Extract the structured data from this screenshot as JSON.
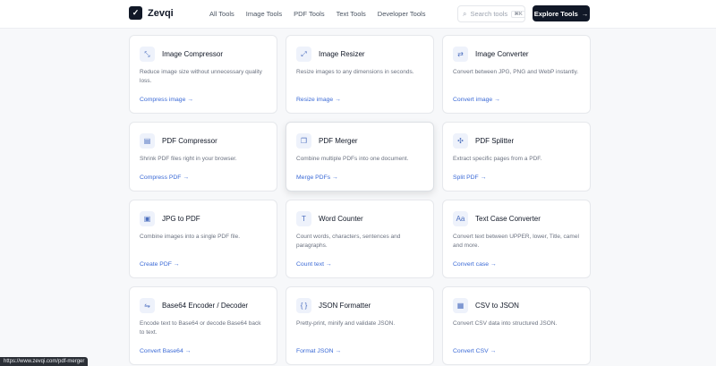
{
  "brand": {
    "name": "Zevqi",
    "mark": "✓"
  },
  "nav": [
    "All Tools",
    "Image Tools",
    "PDF Tools",
    "Text Tools",
    "Developer Tools"
  ],
  "search": {
    "placeholder": "Search tools",
    "shortcut": "⌘K"
  },
  "cta": {
    "label": "Explore Tools",
    "arrow": "→"
  },
  "cards": [
    {
      "title": "Image Compressor",
      "desc": "Reduce image size without unnecessary quality loss.",
      "link": "Compress image →",
      "icon": "⤡",
      "icon_name": "compress-icon"
    },
    {
      "title": "Image Resizer",
      "desc": "Resize images to any dimensions in seconds.",
      "link": "Resize image →",
      "icon": "⤢",
      "icon_name": "resize-icon"
    },
    {
      "title": "Image Converter",
      "desc": "Convert between JPG, PNG and WebP instantly.",
      "link": "Convert image →",
      "icon": "⇄",
      "icon_name": "convert-icon"
    },
    {
      "title": "PDF Compressor",
      "desc": "Shrink PDF files right in your browser.",
      "link": "Compress PDF →",
      "icon": "▤",
      "icon_name": "pdf-file-icon"
    },
    {
      "title": "PDF Merger",
      "desc": "Combine multiple PDFs into one document.",
      "link": "Merge PDFs →",
      "icon": "❐",
      "icon_name": "merge-icon"
    },
    {
      "title": "PDF Splitter",
      "desc": "Extract specific pages from a PDF.",
      "link": "Split PDF →",
      "icon": "✣",
      "icon_name": "split-icon"
    },
    {
      "title": "JPG to PDF",
      "desc": "Combine images into a single PDF file.",
      "link": "Create PDF →",
      "icon": "▣",
      "icon_name": "images-icon"
    },
    {
      "title": "Word Counter",
      "desc": "Count words, characters, sentences and paragraphs.",
      "link": "Count text →",
      "icon": "T",
      "icon_name": "text-icon"
    },
    {
      "title": "Text Case Converter",
      "desc": "Convert text between UPPER, lower, Title, camel and more.",
      "link": "Convert case →",
      "icon": "Aa",
      "icon_name": "case-icon"
    },
    {
      "title": "Base64 Encoder / Decoder",
      "desc": "Encode text to Base64 or decode Base64 back to text.",
      "link": "Convert Base64 →",
      "icon": "⇋",
      "icon_name": "encode-icon"
    },
    {
      "title": "JSON Formatter",
      "desc": "Pretty-print, minify and validate JSON.",
      "link": "Format JSON →",
      "icon": "{ }",
      "icon_name": "braces-icon"
    },
    {
      "title": "CSV to JSON",
      "desc": "Convert CSV data into structured JSON.",
      "link": "Convert CSV →",
      "icon": "▦",
      "icon_name": "table-icon"
    }
  ],
  "status_url": "https://www.zevqi.com/pdf-merger",
  "colors": {
    "accent": "#3b6ad6",
    "dark": "#111827",
    "icon_bg": "#eef2fb"
  }
}
